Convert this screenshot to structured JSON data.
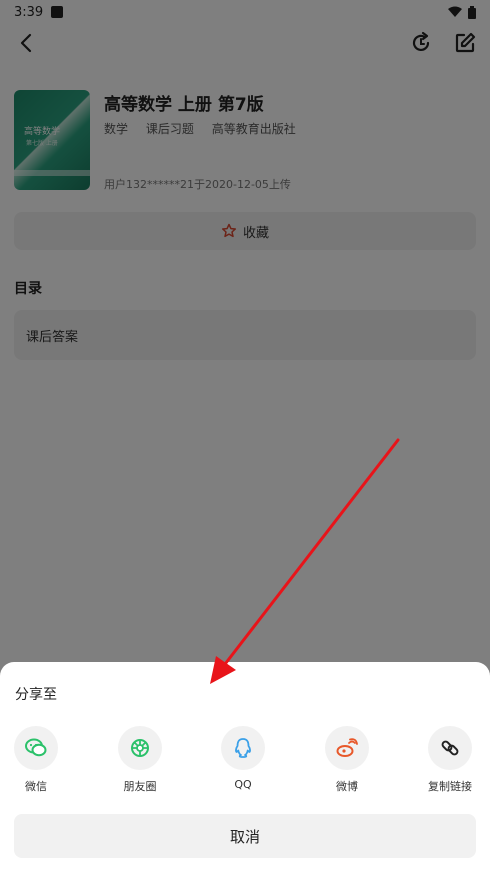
{
  "status_bar": {
    "time": "3:39"
  },
  "book": {
    "title": "高等数学 上册 第7版",
    "tags": [
      "数学",
      "课后习题",
      "高等教育出版社"
    ],
    "uploader_text": "用户132******21于2020-12-05上传",
    "cover_title": "高等数学",
    "cover_subtitle": "第七版 上册"
  },
  "favorite": {
    "label": "收藏"
  },
  "toc": {
    "heading": "目录",
    "items": [
      "课后答案"
    ]
  },
  "share_sheet": {
    "title": "分享至",
    "options": [
      {
        "label": "微信",
        "icon": "wechat-icon"
      },
      {
        "label": "朋友圈",
        "icon": "moments-icon"
      },
      {
        "label": "QQ",
        "icon": "qq-icon"
      },
      {
        "label": "微博",
        "icon": "weibo-icon"
      },
      {
        "label": "复制链接",
        "icon": "link-icon"
      }
    ],
    "cancel_label": "取消"
  },
  "colors": {
    "wechat": "#2bc16a",
    "qq": "#3aa0e8",
    "weibo": "#e8582a",
    "favorite_star": "#d9462f",
    "arrow": "#e8141a"
  }
}
